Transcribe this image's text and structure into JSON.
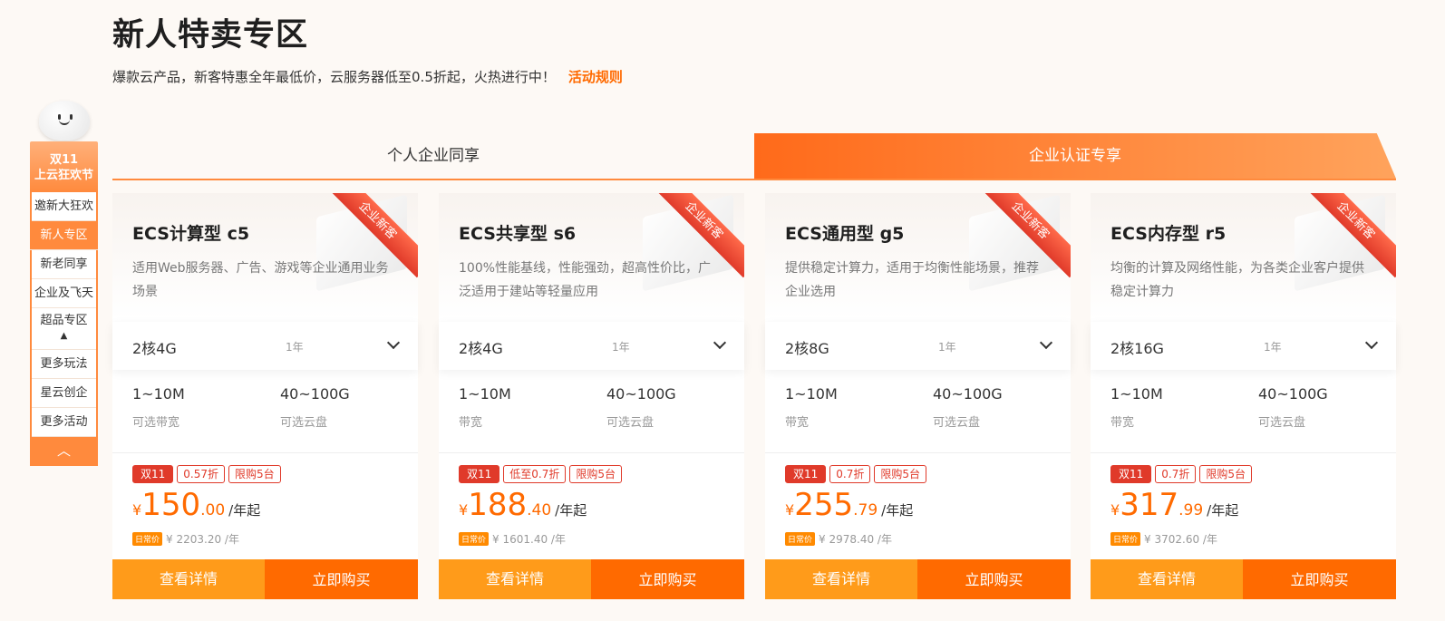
{
  "header": {
    "title": "新人特卖专区",
    "subtitle": "爆款云产品，新客特惠全年最低价，云服务器低至0.5折起，火热进行中！",
    "rules_link": "活动规则"
  },
  "sidebar": {
    "head_line1": "双11",
    "head_line2": "上云狂欢节",
    "items": [
      {
        "label": "邀新大狂欢"
      },
      {
        "label": "新人专区"
      },
      {
        "label": "新老同享"
      },
      {
        "label": "企业及飞天"
      },
      {
        "label": "超品专区"
      },
      {
        "label": "更多玩法"
      },
      {
        "label": "星云创企"
      },
      {
        "label": "更多活动"
      }
    ],
    "collapse_glyph": "▲",
    "up_glyph": "︿"
  },
  "tabs": [
    {
      "label": "个人企业同享"
    },
    {
      "label": "企业认证专享"
    }
  ],
  "accent_colors": {
    "orange": "#ff6a00",
    "light_orange": "#ff9b1a",
    "red": "#e03a2a"
  },
  "cards": [
    {
      "ribbon": "企业新客",
      "name": "ECS计算型 c5",
      "desc": "适用Web服务器、广告、游戏等企业通用业务场景",
      "spec": "2核4G",
      "term": "1年",
      "bandwidth": "1~10M",
      "bandwidth_label": "可选带宽",
      "disk": "40~100G",
      "disk_label": "可选云盘",
      "tags": [
        "双11",
        "0.57折",
        "限购5台"
      ],
      "currency": "¥",
      "price_int": "150",
      "price_dec": ".00",
      "price_unit": "/年起",
      "orig_label": "日常价",
      "orig_price": "¥ 2203.20 /年",
      "detail_btn": "查看详情",
      "buy_btn": "立即购买"
    },
    {
      "ribbon": "企业新客",
      "name": "ECS共享型 s6",
      "desc": "100%性能基线，性能强劲，超高性价比，广泛适用于建站等轻量应用",
      "spec": "2核4G",
      "term": "1年",
      "bandwidth": "1~10M",
      "bandwidth_label": "带宽",
      "disk": "40~100G",
      "disk_label": "可选云盘",
      "tags": [
        "双11",
        "低至0.7折",
        "限购5台"
      ],
      "currency": "¥",
      "price_int": "188",
      "price_dec": ".40",
      "price_unit": "/年起",
      "orig_label": "日常价",
      "orig_price": "¥ 1601.40 /年",
      "detail_btn": "查看详情",
      "buy_btn": "立即购买"
    },
    {
      "ribbon": "企业新客",
      "name": "ECS通用型 g5",
      "desc": "提供稳定计算力，适用于均衡性能场景，推荐企业选用",
      "spec": "2核8G",
      "term": "1年",
      "bandwidth": "1~10M",
      "bandwidth_label": "带宽",
      "disk": "40~100G",
      "disk_label": "可选云盘",
      "tags": [
        "双11",
        "0.7折",
        "限购5台"
      ],
      "currency": "¥",
      "price_int": "255",
      "price_dec": ".79",
      "price_unit": "/年起",
      "orig_label": "日常价",
      "orig_price": "¥ 2978.40 /年",
      "detail_btn": "查看详情",
      "buy_btn": "立即购买"
    },
    {
      "ribbon": "企业新客",
      "name": "ECS内存型 r5",
      "desc": "均衡的计算及网络性能，为各类企业客户提供稳定计算力",
      "spec": "2核16G",
      "term": "1年",
      "bandwidth": "1~10M",
      "bandwidth_label": "带宽",
      "disk": "40~100G",
      "disk_label": "可选云盘",
      "tags": [
        "双11",
        "0.7折",
        "限购5台"
      ],
      "currency": "¥",
      "price_int": "317",
      "price_dec": ".99",
      "price_unit": "/年起",
      "orig_label": "日常价",
      "orig_price": "¥ 3702.60 /年",
      "detail_btn": "查看详情",
      "buy_btn": "立即购买"
    }
  ]
}
